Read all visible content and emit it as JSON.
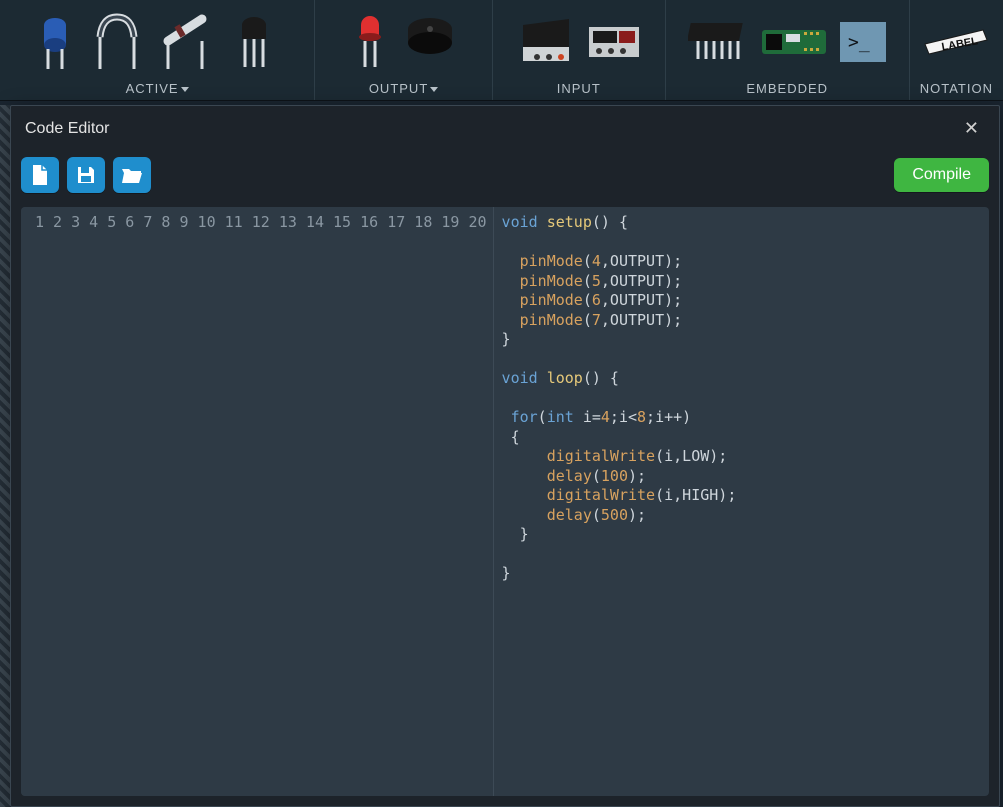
{
  "ribbon": {
    "active_label": "ACTIVE",
    "output_label": "OUTPUT",
    "input_label": "INPUT",
    "embedded_label": "EMBEDDED",
    "notation_label": "NOTATION"
  },
  "editor": {
    "title": "Code Editor",
    "compile_label": "Compile",
    "lines": [
      [
        [
          "void",
          "kw"
        ],
        [
          " ",
          "p"
        ],
        [
          "setup",
          "fn"
        ],
        [
          "()",
          "p"
        ],
        [
          " {",
          "p"
        ]
      ],
      [],
      [
        [
          "  ",
          "p"
        ],
        [
          "pinMode",
          "builtin"
        ],
        [
          "(",
          "p"
        ],
        [
          "4",
          "num"
        ],
        [
          ",OUTPUT);",
          "p"
        ]
      ],
      [
        [
          "  ",
          "p"
        ],
        [
          "pinMode",
          "builtin"
        ],
        [
          "(",
          "p"
        ],
        [
          "5",
          "num"
        ],
        [
          ",OUTPUT);",
          "p"
        ]
      ],
      [
        [
          "  ",
          "p"
        ],
        [
          "pinMode",
          "builtin"
        ],
        [
          "(",
          "p"
        ],
        [
          "6",
          "num"
        ],
        [
          ",OUTPUT);",
          "p"
        ]
      ],
      [
        [
          "  ",
          "p"
        ],
        [
          "pinMode",
          "builtin"
        ],
        [
          "(",
          "p"
        ],
        [
          "7",
          "num"
        ],
        [
          ",OUTPUT);",
          "p"
        ]
      ],
      [
        [
          "}",
          "p"
        ]
      ],
      [],
      [
        [
          "void",
          "kw"
        ],
        [
          " ",
          "p"
        ],
        [
          "loop",
          "fn"
        ],
        [
          "()",
          "p"
        ],
        [
          " {",
          "p"
        ]
      ],
      [],
      [
        [
          " ",
          "p"
        ],
        [
          "for",
          "kw"
        ],
        [
          "(",
          "p"
        ],
        [
          "int",
          "type"
        ],
        [
          " i=",
          "p"
        ],
        [
          "4",
          "num"
        ],
        [
          ";i<",
          "p"
        ],
        [
          "8",
          "num"
        ],
        [
          ";i++)",
          "p"
        ]
      ],
      [
        [
          " {",
          "p"
        ]
      ],
      [
        [
          "     ",
          "p"
        ],
        [
          "digitalWrite",
          "builtin"
        ],
        [
          "(i,LOW);",
          "p"
        ]
      ],
      [
        [
          "     ",
          "p"
        ],
        [
          "delay",
          "builtin"
        ],
        [
          "(",
          "p"
        ],
        [
          "100",
          "num"
        ],
        [
          ");",
          "p"
        ]
      ],
      [
        [
          "     ",
          "p"
        ],
        [
          "digitalWrite",
          "builtin"
        ],
        [
          "(i,HIGH);",
          "p"
        ]
      ],
      [
        [
          "     ",
          "p"
        ],
        [
          "delay",
          "builtin"
        ],
        [
          "(",
          "p"
        ],
        [
          "500",
          "num"
        ],
        [
          ");",
          "p"
        ]
      ],
      [
        [
          "  }",
          "p"
        ]
      ],
      [],
      [
        [
          "}",
          "p"
        ]
      ],
      []
    ]
  }
}
